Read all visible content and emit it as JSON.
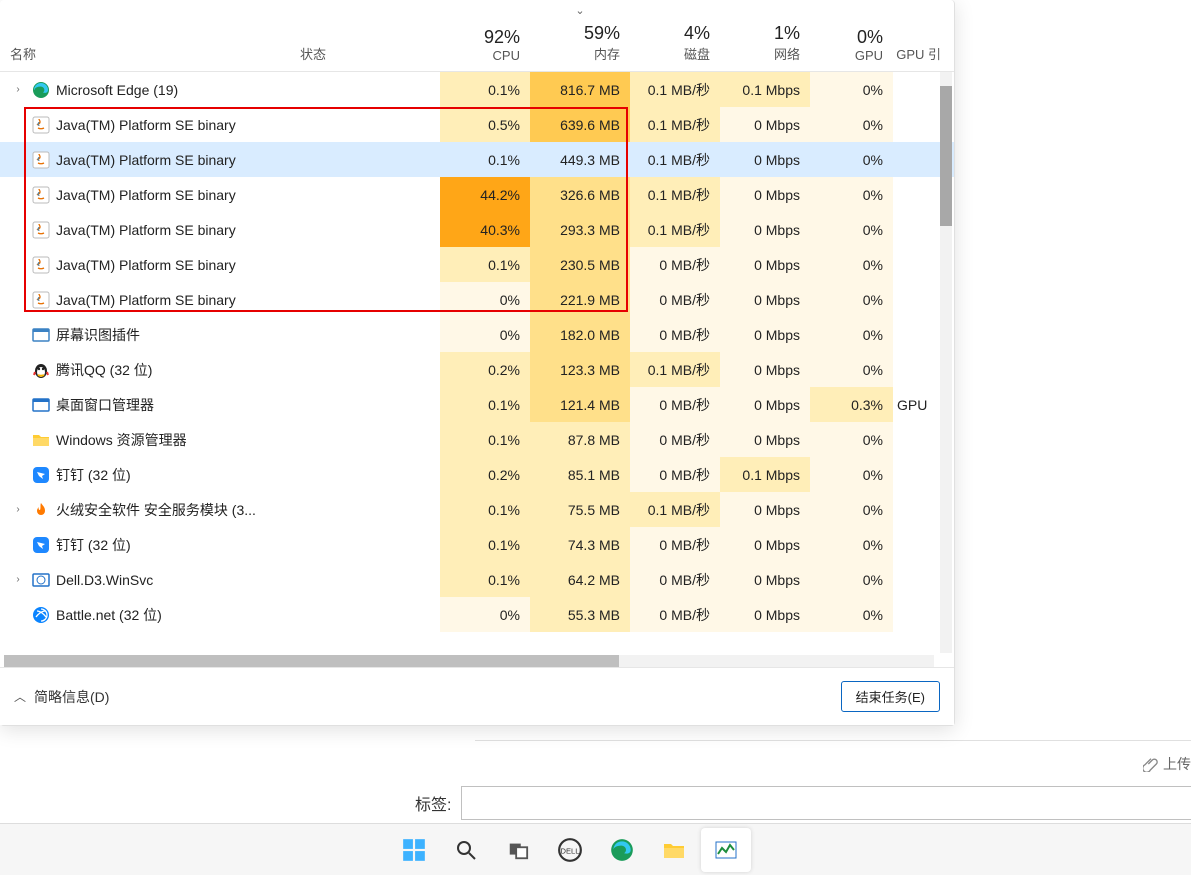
{
  "header": {
    "name_label": "名称",
    "status_label": "状态",
    "cpu": {
      "pct": "92%",
      "label": "CPU"
    },
    "memory": {
      "pct": "59%",
      "label": "内存"
    },
    "disk": {
      "pct": "4%",
      "label": "磁盘"
    },
    "network": {
      "pct": "1%",
      "label": "网络"
    },
    "gpu": {
      "pct": "0%",
      "label": "GPU"
    },
    "gpu_engine": {
      "label": "GPU 引"
    }
  },
  "rows": [
    {
      "expandable": true,
      "icon": "edge",
      "name": "Microsoft Edge (19)",
      "cpu": "0.1%",
      "cpu_h": "h1",
      "mem": "816.7 MB",
      "mem_h": "h3",
      "disk": "0.1 MB/秒",
      "disk_h": "h1",
      "net": "0.1 Mbps",
      "net_h": "h1",
      "gpu": "0%",
      "gpu_h": "h0",
      "gpue": ""
    },
    {
      "expandable": false,
      "icon": "java",
      "name": "Java(TM) Platform SE binary",
      "cpu": "0.5%",
      "cpu_h": "h1",
      "mem": "639.6 MB",
      "mem_h": "h3",
      "disk": "0.1 MB/秒",
      "disk_h": "h1",
      "net": "0 Mbps",
      "net_h": "h0",
      "gpu": "0%",
      "gpu_h": "h0",
      "gpue": ""
    },
    {
      "expandable": false,
      "icon": "java",
      "name": "Java(TM) Platform SE binary",
      "cpu": "0.1%",
      "cpu_h": "h0",
      "mem": "449.3 MB",
      "mem_h": "h0",
      "disk": "0.1 MB/秒",
      "disk_h": "h0",
      "net": "0 Mbps",
      "net_h": "h0",
      "gpu": "0%",
      "gpu_h": "h0",
      "gpue": "",
      "selected": true
    },
    {
      "expandable": false,
      "icon": "java",
      "name": "Java(TM) Platform SE binary",
      "cpu": "44.2%",
      "cpu_h": "h5",
      "mem": "326.6 MB",
      "mem_h": "h2",
      "disk": "0.1 MB/秒",
      "disk_h": "h1",
      "net": "0 Mbps",
      "net_h": "h0",
      "gpu": "0%",
      "gpu_h": "h0",
      "gpue": ""
    },
    {
      "expandable": false,
      "icon": "java",
      "name": "Java(TM) Platform SE binary",
      "cpu": "40.3%",
      "cpu_h": "h5",
      "mem": "293.3 MB",
      "mem_h": "h2",
      "disk": "0.1 MB/秒",
      "disk_h": "h1",
      "net": "0 Mbps",
      "net_h": "h0",
      "gpu": "0%",
      "gpu_h": "h0",
      "gpue": ""
    },
    {
      "expandable": false,
      "icon": "java",
      "name": "Java(TM) Platform SE binary",
      "cpu": "0.1%",
      "cpu_h": "h1",
      "mem": "230.5 MB",
      "mem_h": "h2",
      "disk": "0 MB/秒",
      "disk_h": "h0",
      "net": "0 Mbps",
      "net_h": "h0",
      "gpu": "0%",
      "gpu_h": "h0",
      "gpue": ""
    },
    {
      "expandable": false,
      "icon": "java",
      "name": "Java(TM) Platform SE binary",
      "cpu": "0%",
      "cpu_h": "h0",
      "mem": "221.9 MB",
      "mem_h": "h2",
      "disk": "0 MB/秒",
      "disk_h": "h0",
      "net": "0 Mbps",
      "net_h": "h0",
      "gpu": "0%",
      "gpu_h": "h0",
      "gpue": ""
    },
    {
      "expandable": false,
      "icon": "generic",
      "name": "屏幕识图插件",
      "cpu": "0%",
      "cpu_h": "h0",
      "mem": "182.0 MB",
      "mem_h": "h2",
      "disk": "0 MB/秒",
      "disk_h": "h0",
      "net": "0 Mbps",
      "net_h": "h0",
      "gpu": "0%",
      "gpu_h": "h0",
      "gpue": ""
    },
    {
      "expandable": false,
      "icon": "qq",
      "name": "腾讯QQ (32 位)",
      "cpu": "0.2%",
      "cpu_h": "h1",
      "mem": "123.3 MB",
      "mem_h": "h2",
      "disk": "0.1 MB/秒",
      "disk_h": "h1",
      "net": "0 Mbps",
      "net_h": "h0",
      "gpu": "0%",
      "gpu_h": "h0",
      "gpue": ""
    },
    {
      "expandable": false,
      "icon": "dwm",
      "name": "桌面窗口管理器",
      "cpu": "0.1%",
      "cpu_h": "h1",
      "mem": "121.4 MB",
      "mem_h": "h2",
      "disk": "0 MB/秒",
      "disk_h": "h0",
      "net": "0 Mbps",
      "net_h": "h0",
      "gpu": "0.3%",
      "gpu_h": "h1",
      "gpue": "GPU"
    },
    {
      "expandable": false,
      "icon": "folder",
      "name": "Windows 资源管理器",
      "cpu": "0.1%",
      "cpu_h": "h1",
      "mem": "87.8 MB",
      "mem_h": "h1",
      "disk": "0 MB/秒",
      "disk_h": "h0",
      "net": "0 Mbps",
      "net_h": "h0",
      "gpu": "0%",
      "gpu_h": "h0",
      "gpue": ""
    },
    {
      "expandable": false,
      "icon": "ding",
      "name": "钉钉 (32 位)",
      "cpu": "0.2%",
      "cpu_h": "h1",
      "mem": "85.1 MB",
      "mem_h": "h1",
      "disk": "0 MB/秒",
      "disk_h": "h0",
      "net": "0.1 Mbps",
      "net_h": "h1",
      "gpu": "0%",
      "gpu_h": "h0",
      "gpue": ""
    },
    {
      "expandable": true,
      "icon": "huorong",
      "name": "火绒安全软件 安全服务模块 (3...",
      "cpu": "0.1%",
      "cpu_h": "h1",
      "mem": "75.5 MB",
      "mem_h": "h1",
      "disk": "0.1 MB/秒",
      "disk_h": "h1",
      "net": "0 Mbps",
      "net_h": "h0",
      "gpu": "0%",
      "gpu_h": "h0",
      "gpue": ""
    },
    {
      "expandable": false,
      "icon": "ding",
      "name": "钉钉 (32 位)",
      "cpu": "0.1%",
      "cpu_h": "h1",
      "mem": "74.3 MB",
      "mem_h": "h1",
      "disk": "0 MB/秒",
      "disk_h": "h0",
      "net": "0 Mbps",
      "net_h": "h0",
      "gpu": "0%",
      "gpu_h": "h0",
      "gpue": ""
    },
    {
      "expandable": true,
      "icon": "dell",
      "name": "Dell.D3.WinSvc",
      "cpu": "0.1%",
      "cpu_h": "h1",
      "mem": "64.2 MB",
      "mem_h": "h1",
      "disk": "0 MB/秒",
      "disk_h": "h0",
      "net": "0 Mbps",
      "net_h": "h0",
      "gpu": "0%",
      "gpu_h": "h0",
      "gpue": ""
    },
    {
      "expandable": false,
      "icon": "bnet",
      "name": "Battle.net (32 位)",
      "cpu": "0%",
      "cpu_h": "h0",
      "mem": "55.3 MB",
      "mem_h": "h1",
      "disk": "0 MB/秒",
      "disk_h": "h0",
      "net": "0 Mbps",
      "net_h": "h0",
      "gpu": "0%",
      "gpu_h": "h0",
      "gpue": ""
    }
  ],
  "footer": {
    "brief_label": "简略信息(D)",
    "end_task": "结束任务(E)"
  },
  "bg": {
    "attach_label": "上传",
    "tag_label": "标签:"
  },
  "taskbar_items": [
    "start",
    "search",
    "taskview",
    "dell",
    "edge",
    "explorer",
    "taskmgr"
  ]
}
